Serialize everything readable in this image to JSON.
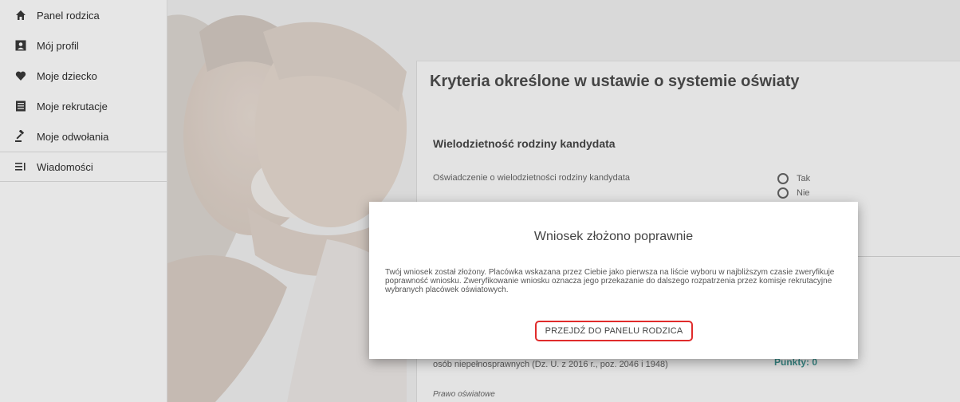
{
  "sidebar": {
    "items": [
      {
        "label": "Panel rodzica",
        "icon": "home-icon"
      },
      {
        "label": "Mój profil",
        "icon": "profile-card-icon"
      },
      {
        "label": "Moje dziecko",
        "icon": "heart-icon"
      },
      {
        "label": "Moje rekrutacje",
        "icon": "document-list-icon"
      },
      {
        "label": "Moje odwołania",
        "icon": "gavel-icon"
      },
      {
        "label": "Wiadomości",
        "icon": "messages-icon"
      }
    ]
  },
  "content": {
    "title": "Kryteria określone w ustawie o systemie oświaty",
    "section_title": "Wielodzietność rodziny kandydata",
    "criterion_text": "Oświadczenie o wielodzietności rodziny kandydata",
    "radio_yes": "Tak",
    "radio_no": "Nie",
    "law_text": "osób niepełnosprawnych (Dz. U. z 2016 r., poz. 2046 i 1948)",
    "points": "Punkty: 0",
    "law_small": "Prawo oświatowe"
  },
  "modal": {
    "title": "Wniosek złożono poprawnie",
    "body": "Twój wniosek został złożony. Placówka wskazana przez Ciebie jako pierwsza na liście wyboru w najbliższym czasie zweryfikuje poprawność wniosku. Zweryfikowanie wniosku oznacza jego przekazanie do dalszego rozpatrzenia przez komisje rekrutacyjne wybranych placówek oświatowych.",
    "button_label": "PRZEJDŹ DO PANELU RODZICA"
  },
  "colors": {
    "accent_red": "#e02b2b",
    "points_teal": "#2a8a87"
  }
}
